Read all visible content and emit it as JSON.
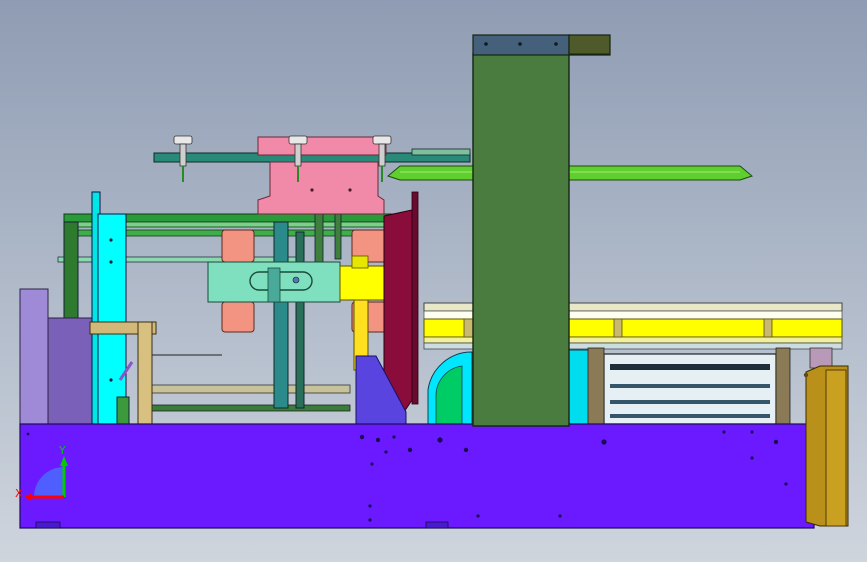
{
  "viewport": {
    "name": "cad-3d-viewport",
    "background_top": "#8f9cb3",
    "background_bottom": "#cfd5dd"
  },
  "triad": {
    "x_label": "X",
    "y_label": "Y",
    "x_color": "#ff0000",
    "y_color": "#00cc00",
    "z_color": "#4a6cff"
  },
  "colors": {
    "base": "#6b1aff",
    "tower": "#4a7c3f",
    "pink": "#f08aa8",
    "salmon": "#f29481",
    "cyan": "#00ffff",
    "mint": "#7fe0bf",
    "yellow": "#ffff00",
    "maroon": "#8a0c3b",
    "tan": "#d2b97a",
    "teal": "#2f8c86",
    "lavender": "#9a85d8",
    "gold": "#b8901a",
    "green": "#1d8c1d",
    "lightgreen": "#7ec820"
  }
}
